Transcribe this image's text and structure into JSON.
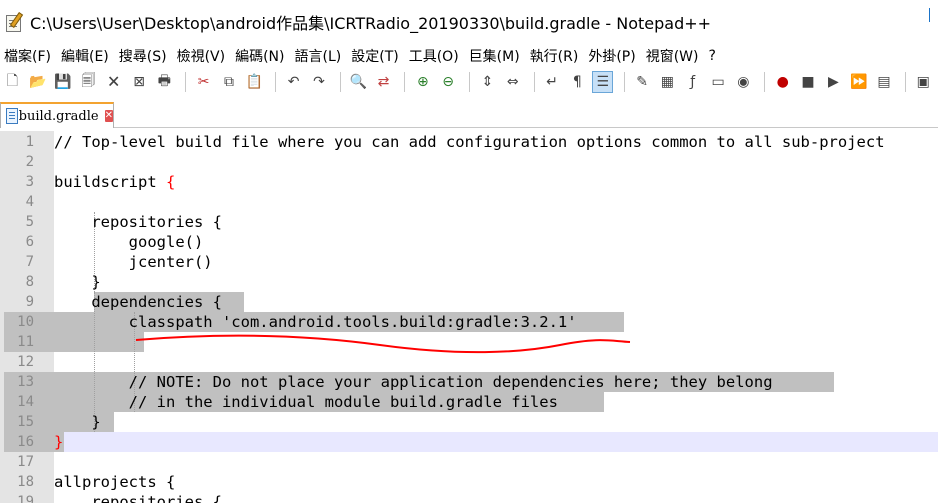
{
  "window": {
    "title": "C:\\Users\\User\\Desktop\\android作品集\\ICRTRadio_20190330\\build.gradle - Notepad++"
  },
  "menu": [
    "檔案(F)",
    "編輯(E)",
    "搜尋(S)",
    "檢視(V)",
    "編碼(N)",
    "語言(L)",
    "設定(T)",
    "工具(O)",
    "巨集(M)",
    "執行(R)",
    "外掛(P)",
    "視窗(W)",
    "?"
  ],
  "toolbar_icons": [
    "new-file",
    "open-file",
    "save",
    "save-all",
    "close",
    "close-all",
    "print",
    "sep",
    "cut",
    "copy",
    "paste",
    "sep",
    "undo",
    "redo",
    "sep",
    "find",
    "replace",
    "sep",
    "zoom-in",
    "zoom-out",
    "sep",
    "sync-vertical",
    "sync-horizontal",
    "sep",
    "word-wrap",
    "show-all-chars",
    "indent-guide",
    "sep",
    "udl",
    "doc-map",
    "function-list",
    "folder-workspace",
    "monitor",
    "sep",
    "record-macro",
    "stop-record",
    "play-macro",
    "play-multiple",
    "save-macro",
    "sep",
    "run"
  ],
  "tab": {
    "label": "build.gradle",
    "close": "✕"
  },
  "lines": [
    {
      "n": "1",
      "text": "// Top-level build file where you can add configuration options common to all sub-project"
    },
    {
      "n": "2",
      "text": ""
    },
    {
      "n": "3",
      "text": "buildscript "
    },
    {
      "n": "4",
      "text": ""
    },
    {
      "n": "5",
      "text": "    repositories {"
    },
    {
      "n": "6",
      "text": "        google()"
    },
    {
      "n": "7",
      "text": "        jcenter()"
    },
    {
      "n": "8",
      "text": "    }"
    },
    {
      "n": "9",
      "text": "    dependencies {"
    },
    {
      "n": "10",
      "text": "        classpath 'com.android.tools.build:gradle:3.2.1'"
    },
    {
      "n": "11",
      "text": ""
    },
    {
      "n": "12",
      "text": ""
    },
    {
      "n": "13",
      "text": "        // NOTE: Do not place your application dependencies here; they belong"
    },
    {
      "n": "14",
      "text": "        // in the individual module build.gradle files"
    },
    {
      "n": "15",
      "text": "    }"
    },
    {
      "n": "16",
      "text": "}"
    },
    {
      "n": "17",
      "text": ""
    },
    {
      "n": "18",
      "text": "allprojects {"
    },
    {
      "n": "19",
      "text": "    repositories {"
    }
  ],
  "brace_open": "{",
  "colors": {
    "selection": "#c0c0c0",
    "current_line": "#e8e8ff",
    "annotation": "#ff0000"
  }
}
